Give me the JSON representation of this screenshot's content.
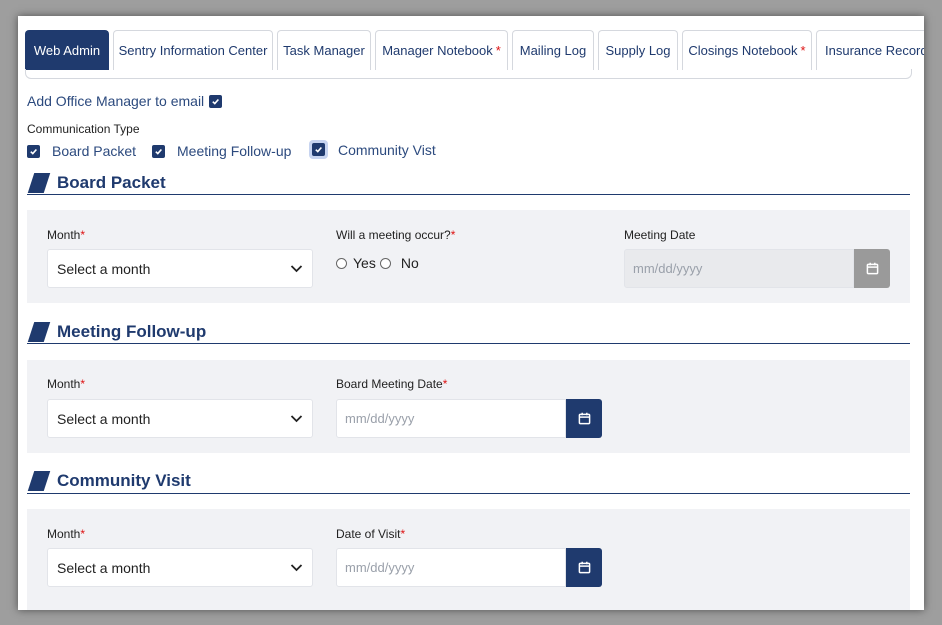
{
  "tabs": [
    {
      "label": "Web Admin",
      "active": true,
      "required": false
    },
    {
      "label": "Sentry Information Center",
      "active": false,
      "required": false
    },
    {
      "label": "Task Manager",
      "active": false,
      "required": false
    },
    {
      "label": "Manager Notebook",
      "active": false,
      "required": true
    },
    {
      "label": "Mailing Log",
      "active": false,
      "required": false
    },
    {
      "label": "Supply Log",
      "active": false,
      "required": false
    },
    {
      "label": "Closings Notebook",
      "active": false,
      "required": true
    },
    {
      "label": "Insurance Record",
      "active": false,
      "required": false
    }
  ],
  "add_office_manager": {
    "label": "Add Office Manager to email",
    "checked": true
  },
  "communication_type": {
    "label": "Communication Type",
    "options": [
      {
        "label": "Board Packet",
        "checked": true
      },
      {
        "label": "Meeting Follow-up",
        "checked": true
      },
      {
        "label": "Community Vist",
        "checked": true,
        "focused": true
      }
    ]
  },
  "required_mark": "*",
  "board_packet": {
    "title": "Board Packet",
    "month_label": "Month",
    "month_value": "Select a month",
    "meeting_question": "Will a meeting occur?",
    "yes_label": "Yes",
    "no_label": "No",
    "meeting_date_label": "Meeting Date",
    "meeting_date_placeholder": "mm/dd/yyyy"
  },
  "meeting_followup": {
    "title": "Meeting Follow-up",
    "month_label": "Month",
    "month_value": "Select a month",
    "board_meeting_date_label": "Board Meeting Date",
    "board_meeting_date_placeholder": "mm/dd/yyyy"
  },
  "community_visit": {
    "title": "Community Visit",
    "month_label": "Month",
    "month_value": "Select a month",
    "date_of_visit_label": "Date of Visit",
    "date_of_visit_placeholder": "mm/dd/yyyy"
  },
  "colors": {
    "primary": "#1f3a6e",
    "required": "#d11111",
    "panel_bg": "#f1f2f5"
  },
  "icons": [
    "check-icon",
    "chevron-down-icon",
    "calendar-icon",
    "section-slash-icon"
  ]
}
